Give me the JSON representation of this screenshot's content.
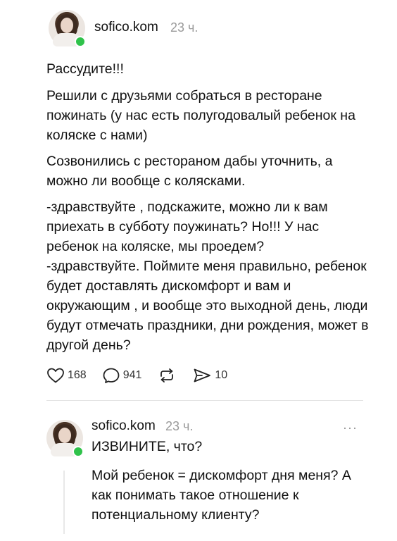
{
  "post": {
    "username": "sofico.kom",
    "time": "23 ч.",
    "paragraphs": [
      "Рассудите!!!",
      "Решили с друзьями собраться в ресторане пожинать (у нас есть полугодовалый ребенок на коляске с нами)",
      "Созвонились с рестораном дабы уточнить, а можно ли вообще с колясками.",
      "-здравствуйте , подскажите, можно ли к вам приехать в субботу поужинать? Но!!! У нас ребенок на коляске, мы проедем?\n-здравствуйте. Поймите меня правильно, ребенок будет доставлять дискомфорт и вам и окружающим , и вообще это выходной день, люди будут отмечать праздники, дни рождения, может в другой день?"
    ],
    "actions": {
      "likes": "168",
      "comments": "941",
      "shares": "10"
    }
  },
  "reply": {
    "username": "sofico.kom",
    "time": "23 ч.",
    "more": "···",
    "text": "ИЗВИНИТЕ, что?",
    "continuation": "Мой ребенок = дискомфорт дня меня? А как понимать такое отношение к потенциальному клиенту?"
  },
  "colors": {
    "online": "#2fc24a",
    "muted": "#9a9a9a",
    "text": "#111111"
  },
  "icons": [
    "heart-icon",
    "comment-icon",
    "repost-icon",
    "share-icon",
    "more-icon"
  ]
}
